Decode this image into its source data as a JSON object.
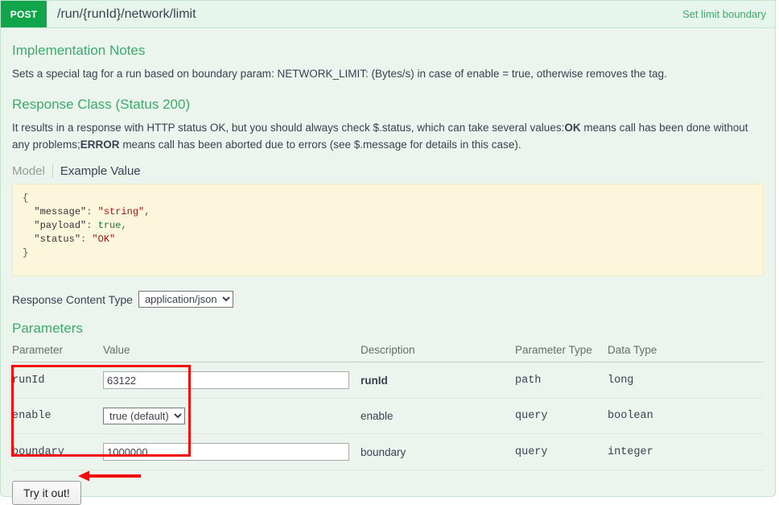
{
  "operation": {
    "method": "POST",
    "path": "/run/{runId}/network/limit",
    "summary": "Set limit boundary"
  },
  "implementation_notes": {
    "title": "Implementation Notes",
    "text": "Sets a special tag for a run based on boundary param: NETWORK_LIMIT: (Bytes/s) in case of enable = true, otherwise removes the tag."
  },
  "response_class": {
    "title": "Response Class (Status 200)",
    "text_part1": "It results in a response with HTTP status OK, but you should always check $.status, which can take several values:",
    "ok_label": "OK",
    "text_part2": " means call has been done without any problems;",
    "error_label": "ERROR",
    "text_part3": " means call has been aborted due to errors (see $.message for details in this case).",
    "tabs": [
      {
        "label": "Model",
        "active": false
      },
      {
        "label": "Example Value",
        "active": true
      }
    ],
    "example_value": {
      "line_open": "{",
      "fields": [
        {
          "key": "\"message\"",
          "sep": ": ",
          "value": "\"string\"",
          "type": "string",
          "comma": ","
        },
        {
          "key": "\"payload\"",
          "sep": ": ",
          "value": "true",
          "type": "bool",
          "comma": ","
        },
        {
          "key": "\"status\"",
          "sep": ": ",
          "value": "\"OK\"",
          "type": "string",
          "comma": ""
        }
      ],
      "line_close": "}"
    }
  },
  "response_content_type": {
    "label": "Response Content Type",
    "selected": "application/json",
    "options": [
      "application/json"
    ]
  },
  "parameters_section": {
    "title": "Parameters",
    "columns": [
      "Parameter",
      "Value",
      "Description",
      "Parameter Type",
      "Data Type"
    ],
    "rows": [
      {
        "name": "runId",
        "control": "input",
        "value": "63122",
        "placeholder": "",
        "description": "runId",
        "required": true,
        "parameter_type": "path",
        "data_type": "long"
      },
      {
        "name": "enable",
        "control": "select",
        "value": "true (default)",
        "options": [
          "true (default)",
          "false"
        ],
        "description": "enable",
        "required": false,
        "parameter_type": "query",
        "data_type": "boolean"
      },
      {
        "name": "boundary",
        "control": "input",
        "value": "1000000",
        "placeholder": "",
        "description": "boundary",
        "required": false,
        "parameter_type": "query",
        "data_type": "integer"
      }
    ]
  },
  "submit": {
    "label": "Try it out!"
  },
  "annotations": {
    "highlight_color": "#f20d0d",
    "box_target": "parameters-input-column",
    "arrow_target": "try-it-out-button",
    "arrow_direction": "left"
  },
  "colors": {
    "method_badge": "#10a54a",
    "accent_green": "#3bab6b",
    "panel_bg": "#ecf4ee",
    "code_bg": "#fcf6dd"
  }
}
